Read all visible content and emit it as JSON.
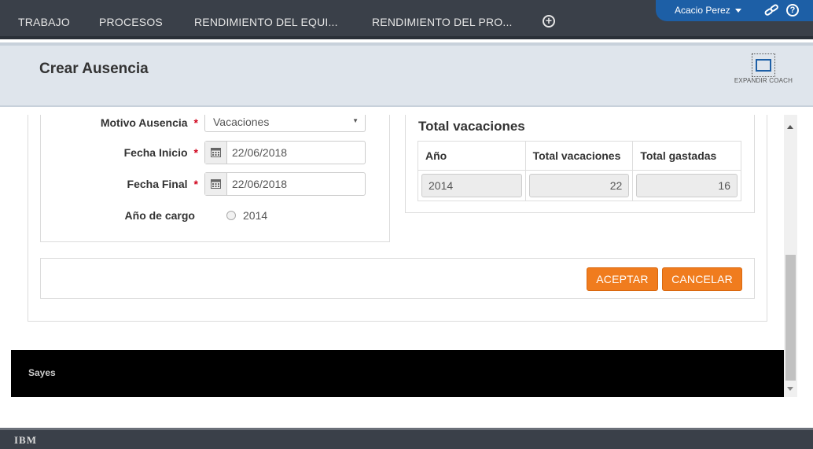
{
  "nav": {
    "tabs": [
      "TRABAJO",
      "PROCESOS",
      "RENDIMIENTO DEL EQUI...",
      "RENDIMIENTO DEL PRO..."
    ],
    "add_icon": "plus-circle-icon"
  },
  "user": {
    "name": "Acacio Perez",
    "link_icon": "link-icon",
    "help_icon": "help-icon"
  },
  "header": {
    "title": "Crear Ausencia",
    "expand_label": "EXPANDIR COACH"
  },
  "form": {
    "motivo_label": "Motivo Ausencia",
    "motivo_value": "Vacaciones",
    "fecha_inicio_label": "Fecha Inicio",
    "fecha_inicio_value": "22/06/2018",
    "fecha_final_label": "Fecha Final",
    "fecha_final_value": "22/06/2018",
    "anio_cargo_label": "Año de cargo",
    "anio_cargo_option": "2014",
    "required_mark": "*"
  },
  "vacaciones": {
    "title": "Total vacaciones",
    "headers": [
      "Año",
      "Total vacaciones",
      "Total gastadas"
    ],
    "row": [
      "2014",
      "22",
      "16"
    ]
  },
  "buttons": {
    "accept": "ACEPTAR",
    "cancel": "CANCELAR"
  },
  "footer": {
    "text": "Sayes",
    "brand": "IBM"
  },
  "colors": {
    "accent": "#f07c1e",
    "nav_bg": "#3a4049",
    "user_bg": "#1d5fa6",
    "required": "#d0021b"
  }
}
